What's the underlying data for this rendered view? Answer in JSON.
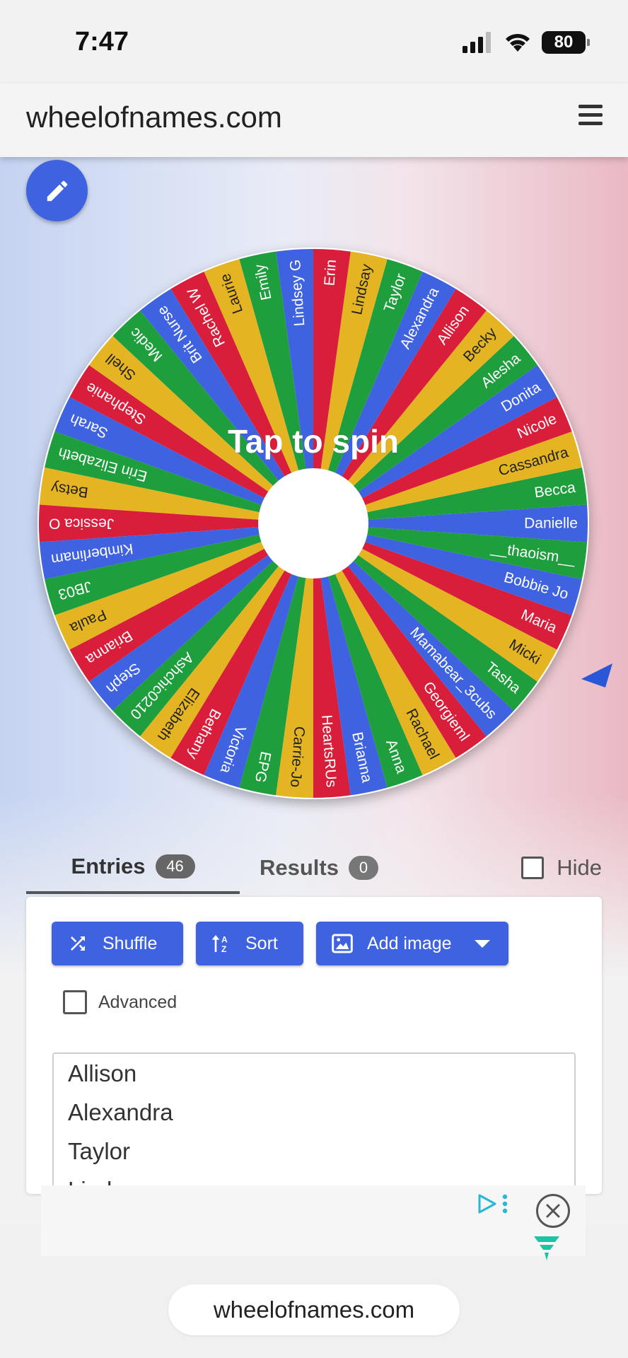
{
  "status_bar": {
    "time": "7:47",
    "battery": "80"
  },
  "header": {
    "site_name": "wheelofnames.com"
  },
  "wheel": {
    "spin_label": "Tap to spin",
    "colors": [
      "#3f63e0",
      "#1e9e3c",
      "#e5b423",
      "#d81e3a"
    ],
    "pointer_color": "#2a57d6",
    "segments": [
      "Danielle",
      "Becca",
      "Cassandra",
      "Nicole",
      "Donita",
      "Alesha",
      "Becky",
      "Allison",
      "Alexandra",
      "Taylor",
      "Lindsay",
      "Erin",
      "Lindsey G",
      "Emily",
      "Laurie",
      "Rachel W",
      "Brit Nurse",
      "Medic",
      "Shell",
      "Stephanie",
      "Sarah",
      "Erin Elizabeth",
      "Betsy",
      "Jessica O",
      "Kimberlinam",
      "JB03",
      "Paula",
      "Brianna",
      "Steph",
      "Ashchic0210",
      "Elizabeth",
      "Bethany",
      "Victoria",
      "EPG",
      "Carrie-Jo",
      "HeartsRUs",
      "Brianna",
      "Anna",
      "Rachael",
      "Georgieml",
      "Mamabear_3cubs",
      "Tasha",
      "Micki",
      "Maria",
      "Bobbie Jo",
      "__thaoism__"
    ]
  },
  "tabs": {
    "entries_label": "Entries",
    "entries_count": "46",
    "results_label": "Results",
    "results_count": "0",
    "hide_label": "Hide"
  },
  "toolbar": {
    "shuffle_label": "Shuffle",
    "sort_label": "Sort",
    "add_image_label": "Add image",
    "advanced_label": "Advanced"
  },
  "entries_list": [
    "Allison",
    "Alexandra",
    "Taylor",
    "Lindsay"
  ],
  "browser": {
    "url": "wheelofnames.com"
  }
}
